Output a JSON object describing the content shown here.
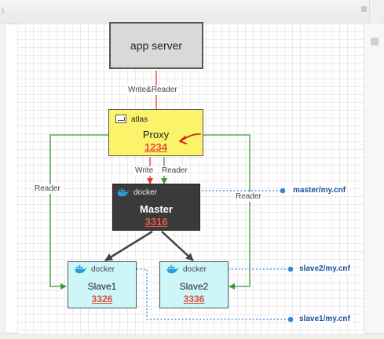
{
  "nodes": {
    "app_server": {
      "label": "app server"
    },
    "proxy": {
      "tag": "atlas",
      "title": "Proxy",
      "port": "1234"
    },
    "master": {
      "tag": "docker",
      "title": "Master",
      "port": "3316"
    },
    "slave1": {
      "tag": "docker",
      "title": "Slave1",
      "port": "3326"
    },
    "slave2": {
      "tag": "docker",
      "title": "Slave2",
      "port": "3336"
    }
  },
  "edges": {
    "app_to_proxy": "Write&Reader",
    "proxy_to_master_write": "Write",
    "proxy_to_master_reader": "Reader",
    "proxy_to_slave1_reader": "Reader",
    "proxy_to_slave2_reader": "Reader"
  },
  "config_files": {
    "master": "master/my.cnf",
    "slave2": "slave2/my.cnf",
    "slave1": "slave1/my.cnf"
  },
  "colors": {
    "write_edge": "#e33b2e",
    "reader_edge": "#3c9a3c",
    "config_link": "#3a86d6",
    "proxy_fill": "#fbf36a",
    "master_fill": "#3a3a3a",
    "slave_fill": "#ccf6f8"
  }
}
